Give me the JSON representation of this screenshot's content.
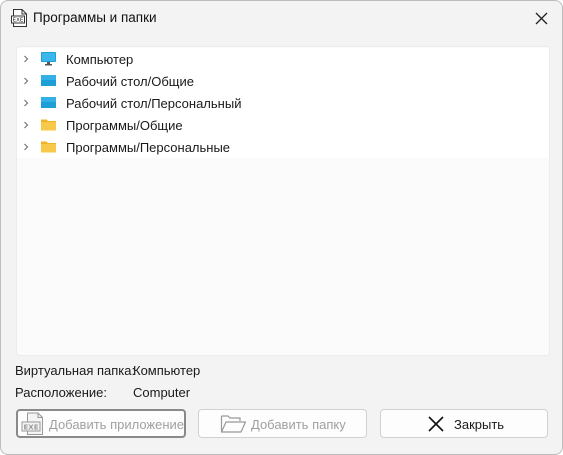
{
  "window": {
    "title": "Программы и папки",
    "title_icon": "exe-file-icon",
    "close_icon": "close-icon"
  },
  "tree": {
    "items": [
      {
        "label": "Компьютер",
        "icon": "monitor-icon",
        "expandable": true
      },
      {
        "label": "Рабочий стол/Общие",
        "icon": "desktop-icon",
        "expandable": true
      },
      {
        "label": "Рабочий стол/Персональный",
        "icon": "desktop-icon",
        "expandable": true
      },
      {
        "label": "Программы/Общие",
        "icon": "folder-icon",
        "expandable": true
      },
      {
        "label": "Программы/Персональные",
        "icon": "folder-icon",
        "expandable": true
      }
    ]
  },
  "info": {
    "virtual_folder_label": "Виртуальная папка:",
    "virtual_folder_value": "Компьютер",
    "location_label": "Расположение:",
    "location_value": "Computer"
  },
  "buttons": {
    "add_app": {
      "label": "Добавить приложение",
      "enabled": false,
      "icon": "exe-icon"
    },
    "add_folder": {
      "label": "Добавить папку",
      "enabled": false,
      "icon": "open-folder-icon"
    },
    "close": {
      "label": "Закрыть",
      "enabled": true,
      "icon": "close-icon"
    }
  },
  "colors": {
    "window_bg": "#f3f3f3",
    "panel_bg": "#fbfbfb",
    "folder_yellow": "#f8c84a",
    "desktop_blue": "#1e9fd8",
    "disabled_text": "#a0a0a0"
  }
}
